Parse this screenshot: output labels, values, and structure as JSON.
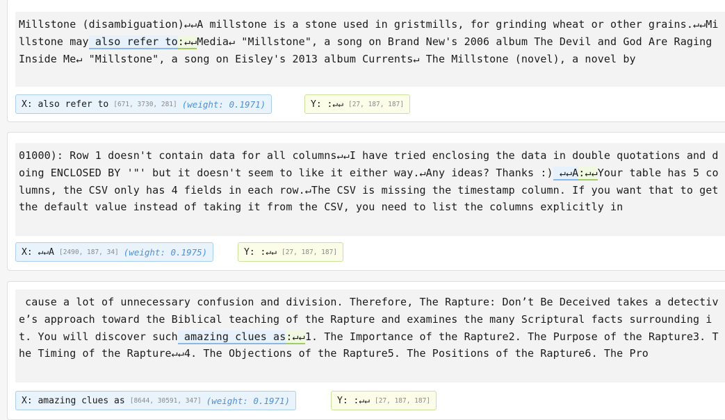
{
  "examples": [
    {
      "text_pre": "Millstone (disambiguation)↵↵A millstone is a stone used in gristmills, for grinding wheat or other grains.↵↵Millstone may",
      "text_x": " also refer to",
      "text_y": ":↵↵",
      "text_post": "Media↵ \"Millstone\", a song on Brand New's 2006 album The Devil and God Are Raging Inside Me↵ \"Millstone\", a song on Eisley's 2013 album Currents↵ The Millstone (novel), a novel by",
      "x_label": "X: also refer to",
      "x_ids": "[671, 3730, 281]",
      "x_weight": "(weight: 0.1971)",
      "y_label": "Y: :↵↵",
      "y_ids": "[27, 187, 187]"
    },
    {
      "text_pre": "01000): Row 1 doesn't contain data for all columns↵↵I have tried enclosing the data in double quotations and doing ENCLOSED BY '\"' but it doesn't seem to like it either way.↵Any ideas? Thanks :)",
      "text_x": " ↵↵A",
      "text_y": ":↵↵",
      "text_post": "Your table has 5 columns, the CSV only has 4 fields in each row.↵The CSV is missing the timestamp column. If you want that to get the default value instead of taking it from the CSV, you need to list the columns explicitly in",
      "x_label": "X: ↵↵A",
      "x_ids": "[2490, 187, 34]",
      "x_weight": "(weight: 0.1975)",
      "y_label": "Y: :↵↵",
      "y_ids": "[27, 187, 187]"
    },
    {
      "text_pre": " cause a lot of unnecessary confusion and division. Therefore, The Rapture: Don’t Be Deceived takes a detective’s approach toward the Biblical teaching of the Rapture and examines the many Scriptural facts surrounding it. You will discover such",
      "text_x": " amazing clues as",
      "text_y": ":↵↵",
      "text_post": "1. The Importance of the Rapture2. The Purpose of the Rapture3. The Timing of the Rapture↵↵4. The Objections of the Rapture5. The Positions of the Rapture6. The Pro",
      "x_label": "X: amazing clues as",
      "x_ids": "[8644, 30591, 347]",
      "x_weight": "(weight: 0.1971)",
      "y_label": "Y: :↵↵",
      "y_ids": "[27, 187, 187]"
    }
  ]
}
